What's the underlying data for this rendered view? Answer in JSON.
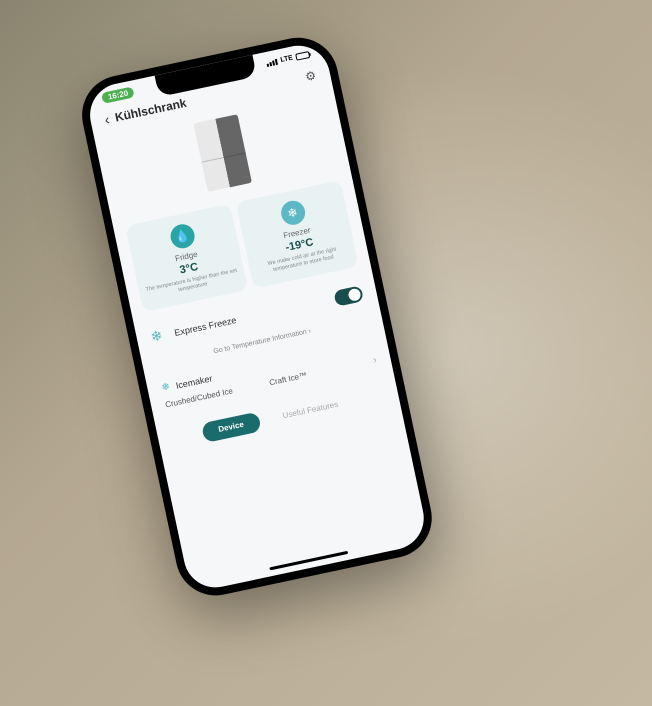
{
  "status": {
    "time": "16:20",
    "network": "LTE"
  },
  "header": {
    "title": "Kühlschrank"
  },
  "fridge": {
    "label": "Fridge",
    "temp": "3°C",
    "desc": "The temperature is higher than the set temperature"
  },
  "freezer": {
    "label": "Freezer",
    "temp": "-19°C",
    "desc": "We make cold air at the right temperature to store food"
  },
  "express": {
    "label": "Express Freeze"
  },
  "tempInfo": {
    "label": "Go to Temperature Information"
  },
  "icemaker": {
    "title": "Icemaker",
    "option1": "Crushed/Cubed Ice",
    "option2": "Craft Ice™"
  },
  "tabs": {
    "device": "Device",
    "features": "Useful Features"
  }
}
